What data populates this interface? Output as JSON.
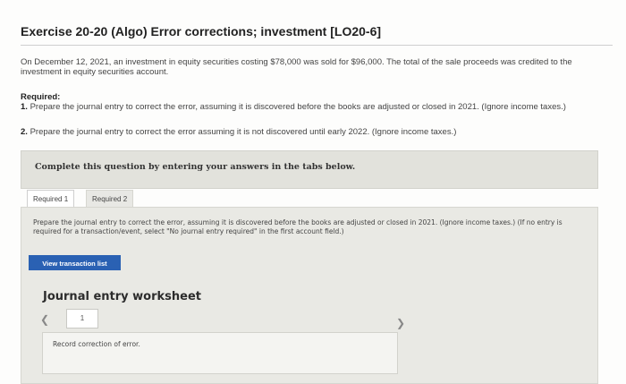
{
  "title": "Exercise 20-20 (Algo) Error corrections; investment [LO20-6]",
  "intro": "On December 12, 2021, an investment in equity securities costing $78,000 was sold for $96,000. The total of the sale proceeds was credited to the investment in equity securities account.",
  "required_label": "Required:",
  "req1_num": "1.",
  "req1_text": " Prepare the journal entry to correct the error, assuming it is discovered before the books are adjusted or closed in 2021. (Ignore income taxes.)",
  "req2_num": "2.",
  "req2_text": " Prepare the journal entry to correct the error assuming it is not discovered until early 2022. (Ignore income taxes.)",
  "complete_text": "Complete this question by entering your answers in the tabs below.",
  "tabs": [
    "Required 1",
    "Required 2"
  ],
  "panel_instruction": "Prepare the journal entry to correct the error, assuming it is discovered before the books are adjusted or closed in 2021. (Ignore income taxes.) (If no entry is required for a transaction/event, select \"No journal entry required\" in the first account field.)",
  "view_button": "View transaction list",
  "worksheet_title": "Journal entry worksheet",
  "page_number": "1",
  "record_text": "Record correction of error.",
  "icons": {
    "prev": "chevron-left-icon",
    "next": "chevron-right-icon"
  },
  "colors": {
    "button": "#2a61b3",
    "panel": "#e9e9e4"
  }
}
